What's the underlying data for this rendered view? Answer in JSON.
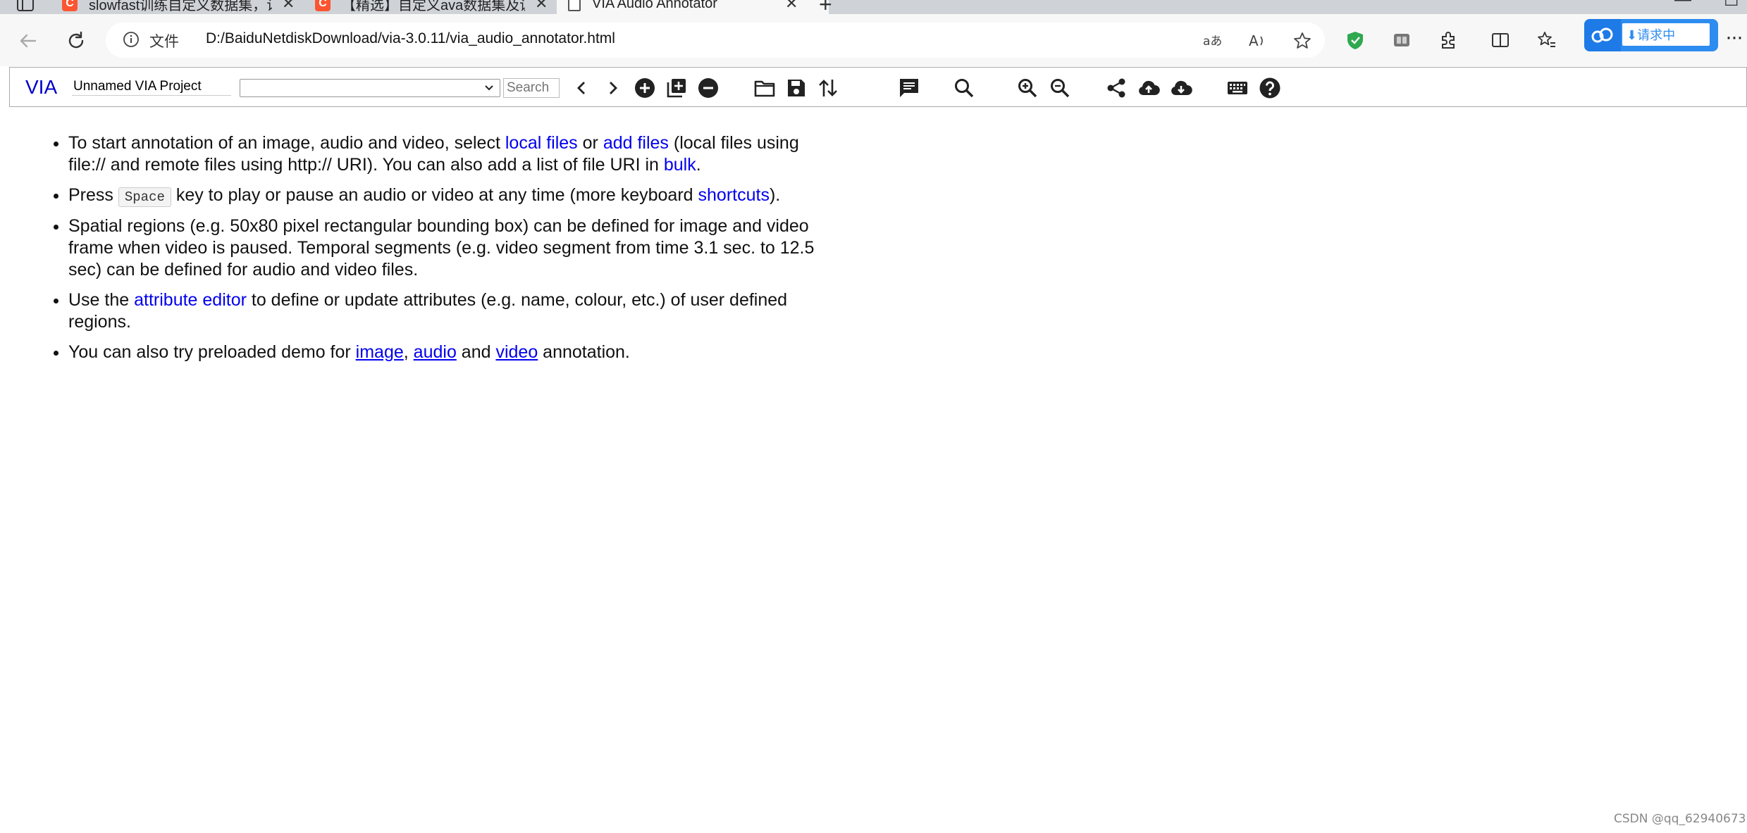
{
  "browser": {
    "tabs": [
      {
        "title": "slowfast训练自定义数据集，识别",
        "favicon": "csdn-icon"
      },
      {
        "title": "【精选】自定义ava数据集及训练",
        "favicon": "csdn-icon"
      },
      {
        "title": "VIA Audio Annotator",
        "favicon": "page-icon",
        "active": true
      }
    ],
    "address": {
      "scheme_label": "文件",
      "url": "D:/BaiduNetdiskDownload/via-3.0.11/via_audio_annotator.html"
    },
    "extension": {
      "label": "⬇请求中",
      "brand_color": "#2d8cf0"
    }
  },
  "toolbar": {
    "logo": "VIA",
    "project_name": "Unnamed VIA Project",
    "file_select_value": "",
    "search_placeholder": "Search",
    "accent_color": "#0000cc"
  },
  "help": {
    "item1": {
      "t1": "To start annotation of an image, audio and video, select ",
      "local_files": "local files",
      "t2": " or ",
      "add_files": "add files",
      "t3": " (local files using file:// and remote files using http:// URI). You can also add a list of file URI in ",
      "bulk": "bulk",
      "t4": "."
    },
    "item2": {
      "t1": "Press ",
      "key": "Space",
      "t2": " key to play or pause an audio or video at any time (more keyboard ",
      "shortcuts": "shortcuts",
      "t3": ")."
    },
    "item3": {
      "text": "Spatial regions (e.g. 50x80 pixel rectangular bounding box) can be defined for image and video frame when video is paused. Temporal segments (e.g. video segment from time 3.1 sec. to 12.5 sec) can be defined for audio and video files."
    },
    "item4": {
      "t1": "Use the ",
      "attribute_editor": "attribute editor",
      "t2": " to define or update attributes (e.g. name, colour, etc.) of user defined regions."
    },
    "item5": {
      "t1": "You can also try preloaded demo for ",
      "image": "image",
      "sep1": ", ",
      "audio": "audio",
      "sep2": " and ",
      "video": "video",
      "t2": " annotation."
    }
  },
  "watermark": "CSDN @qq_62940673"
}
